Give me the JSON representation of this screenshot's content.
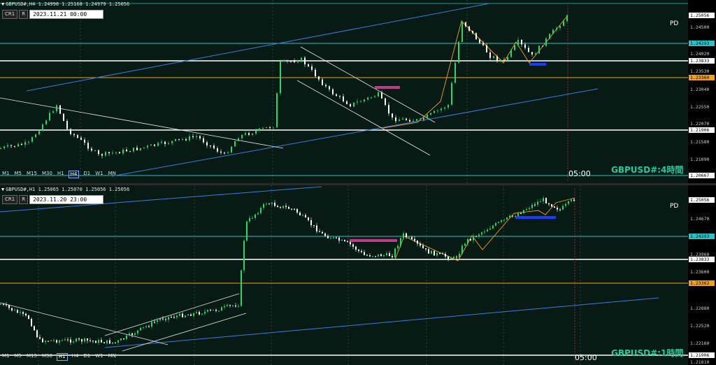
{
  "panel_h4": {
    "symbol_info": "GBPUSD#,H4  1.24998 1.25168 1.24979 1.25056",
    "btn_cr1": "CR1",
    "btn_r": "R",
    "date": "2023.11.21 00:00",
    "pd": "PD",
    "title": "GBPUSD#:4時間",
    "time_marker": "05:00",
    "timeframes": [
      "M1",
      "M5",
      "M15",
      "M30",
      "H1",
      "H4",
      "D1",
      "W1",
      "MN"
    ],
    "active_timeframe": "H4",
    "scale_ticks": [
      "1.24500",
      "1.24020",
      "1.23530",
      "1.23040",
      "1.22550",
      "1.22070",
      "1.21580",
      "1.21090"
    ],
    "price_boxes": {
      "current": "1.25056",
      "cyan": "1.24293",
      "white_top": "1.23833",
      "orange": "1.23360",
      "white_mid": "1.21906",
      "bottom": "1.20667"
    }
  },
  "panel_h1": {
    "symbol_info": "GBPUSD#,H1  1.25065 1.25070 1.25056 1.25056",
    "btn_cr1": "CR1",
    "btn_r": "R",
    "date": "2023.11.20 23:00",
    "pd": "PD",
    "title": "GBPUSD#:1時間",
    "time_marker": "05:00",
    "timeframes": [
      "M1",
      "M5",
      "M15",
      "M30",
      "H1",
      "H4",
      "D1",
      "W1",
      "MN"
    ],
    "active_timeframe": "H1",
    "scale_ticks": [
      "1.24670",
      "1.23960",
      "1.23600",
      "1.22880",
      "1.22520",
      "1.22160",
      "1.21810"
    ],
    "price_boxes": {
      "current": "1.25056",
      "cyan": "1.24293",
      "white_top": "1.23833",
      "orange": "1.23362",
      "white_bottom": "1.21906"
    }
  },
  "colors": {
    "bg": "#071a14",
    "bull": "#2bd46c",
    "bear": "#ffffff",
    "cyan": "#2ec3c3",
    "orange": "#f0a020",
    "blue_trend": "#3a7ce0",
    "magenta": "#c03a8a",
    "accent_label": "#28c79c"
  }
}
